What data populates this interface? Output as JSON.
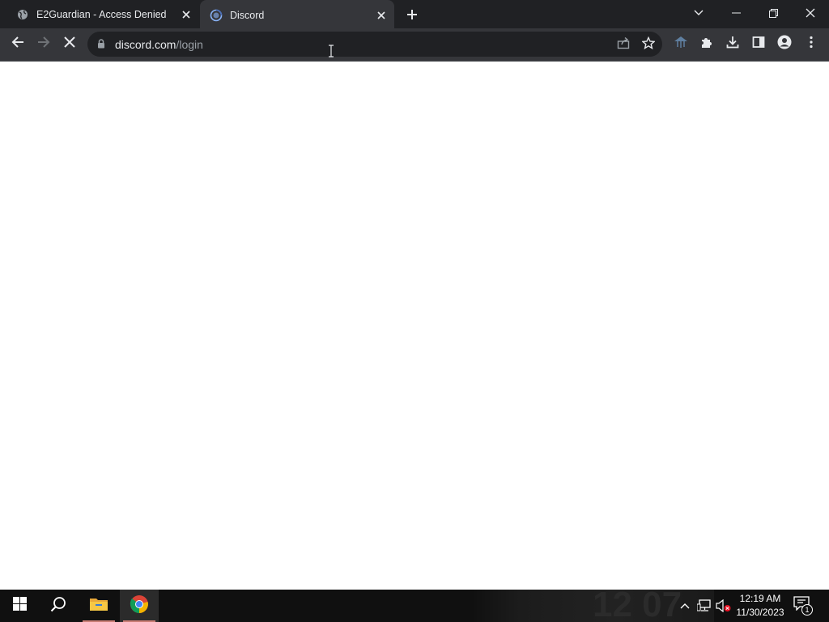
{
  "browser": {
    "tabs": [
      {
        "title": "E2Guardian - Access Denied",
        "favicon": "globe-icon",
        "active": false
      },
      {
        "title": "Discord",
        "favicon": "discord-loading-icon",
        "active": true
      }
    ],
    "url_host": "discord.com",
    "url_path": "/login",
    "loading": true
  },
  "taskbar": {
    "apps": [
      {
        "name": "File Explorer",
        "icon": "folder-icon"
      },
      {
        "name": "Google Chrome",
        "icon": "chrome-icon"
      }
    ],
    "time": "12:19 AM",
    "date": "11/30/2023",
    "notification_count": "1",
    "wallpaper_clock_text": "12 07"
  },
  "colors": {
    "tabstrip_bg": "#202124",
    "toolbar_bg": "#35363a",
    "omnibox_bg": "#202124",
    "taskbar_bg": "#101010"
  }
}
